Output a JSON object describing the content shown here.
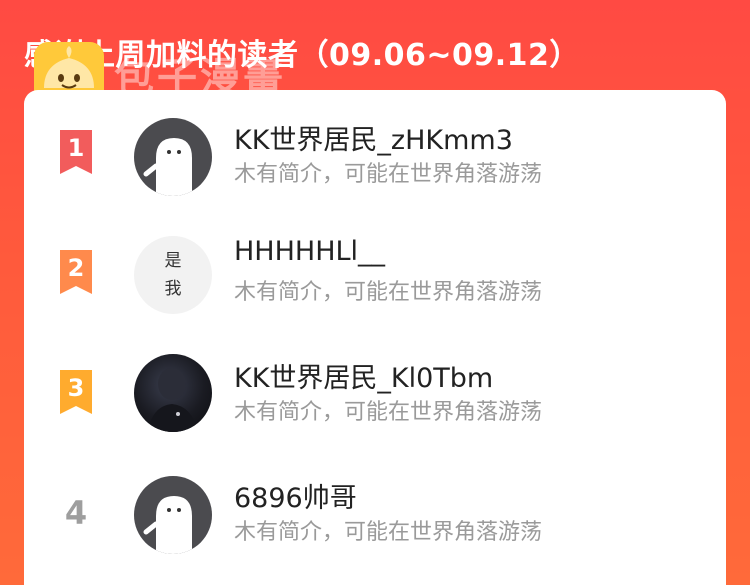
{
  "header": {
    "title": "感谢上周加料的读者（09.06~09.12）"
  },
  "watermark": {
    "text": "包子漫畫",
    "logo_icon": "bun-logo-icon"
  },
  "colors": {
    "background": "#ff4a43",
    "rank1": "#f25c5c",
    "rank2": "#ff8a4c",
    "rank3": "#ffab2e",
    "rank_plain": "#9e9e9e"
  },
  "readers": [
    {
      "rank": "1",
      "name": "KK世界居民_zHKmm3",
      "desc": "木有简介，可能在世界角落游荡",
      "avatar": "ghost-avatar-icon"
    },
    {
      "rank": "2",
      "name": "HHHHHLl__",
      "desc": "木有简介，可能在世界角落游荡",
      "avatar_text_1": "是",
      "avatar_text_2": "我"
    },
    {
      "rank": "3",
      "name": "KK世界居民_Kl0Tbm",
      "desc": "木有简介，可能在世界角落游荡",
      "avatar": "photo-avatar"
    },
    {
      "rank": "4",
      "name": "6896帅哥",
      "desc": "木有简介，可能在世界角落游荡",
      "avatar": "ghost-avatar-icon"
    }
  ]
}
